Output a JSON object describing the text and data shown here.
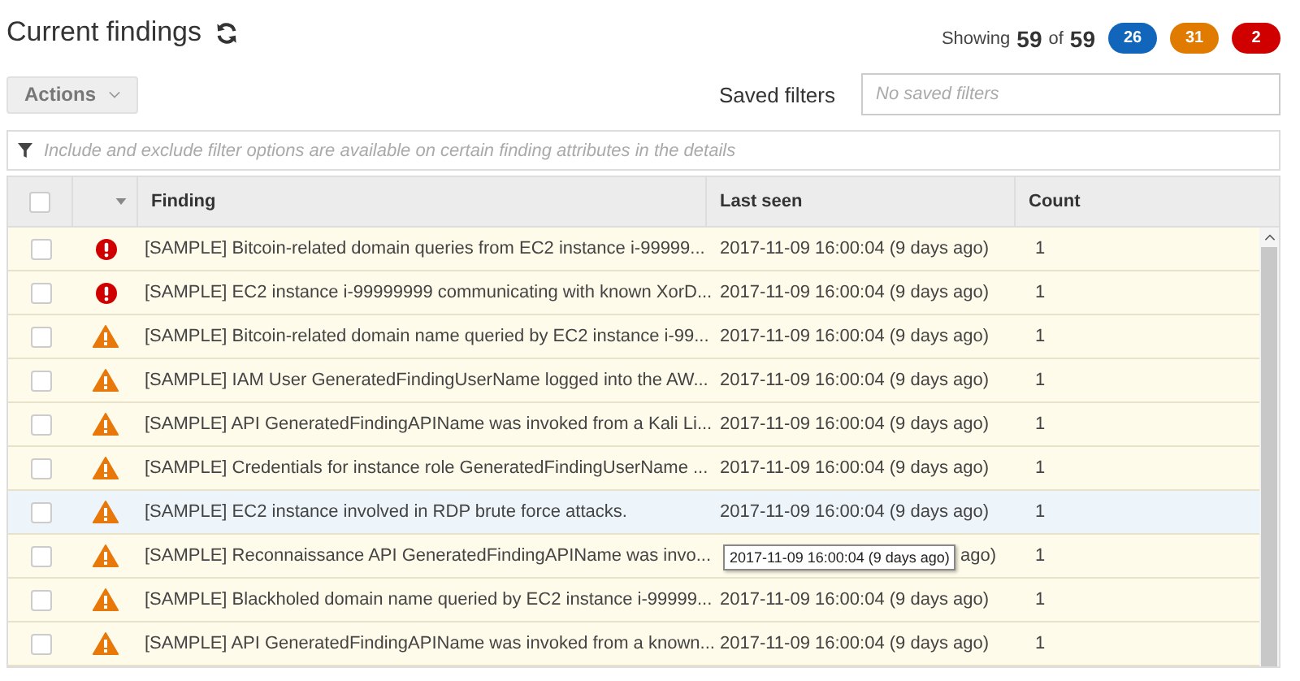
{
  "title": "Current findings",
  "summary": {
    "showing_label": "Showing",
    "shown": "59",
    "of_label": "of",
    "total": "59"
  },
  "severity_badges": [
    {
      "count": "26",
      "color": "#1166bb"
    },
    {
      "count": "31",
      "color": "#e07b00"
    },
    {
      "count": "2",
      "color": "#d00000"
    }
  ],
  "actions_button": {
    "label": "Actions"
  },
  "saved_filters": {
    "label": "Saved filters",
    "placeholder": "No saved filters"
  },
  "filter_bar": {
    "placeholder": "Include and exclude filter options are available on certain finding attributes in the details"
  },
  "table": {
    "select_all": {
      "checked": false
    },
    "columns": [
      "Finding",
      "Last seen",
      "Count"
    ],
    "rows": [
      {
        "kind": "error",
        "checked": false,
        "highlighted": false,
        "finding": "[SAMPLE] Bitcoin-related domain queries from EC2 instance i-99999...",
        "last_seen": "2017-11-09 16:00:04 (9 days ago)",
        "count": "1"
      },
      {
        "kind": "error",
        "checked": false,
        "highlighted": false,
        "finding": "[SAMPLE] EC2 instance i-99999999 communicating with known XorD...",
        "last_seen": "2017-11-09 16:00:04 (9 days ago)",
        "count": "1"
      },
      {
        "kind": "warning",
        "checked": false,
        "highlighted": false,
        "finding": "[SAMPLE] Bitcoin-related domain name queried by EC2 instance i-99...",
        "last_seen": "2017-11-09 16:00:04 (9 days ago)",
        "count": "1"
      },
      {
        "kind": "warning",
        "checked": false,
        "highlighted": false,
        "finding": "[SAMPLE] IAM User GeneratedFindingUserName logged into the AW...",
        "last_seen": "2017-11-09 16:00:04 (9 days ago)",
        "count": "1"
      },
      {
        "kind": "warning",
        "checked": false,
        "highlighted": false,
        "finding": "[SAMPLE] API GeneratedFindingAPIName was invoked from a Kali Li...",
        "last_seen": "2017-11-09 16:00:04 (9 days ago)",
        "count": "1"
      },
      {
        "kind": "warning",
        "checked": false,
        "highlighted": false,
        "finding": "[SAMPLE] Credentials for instance role GeneratedFindingUserName ...",
        "last_seen": "2017-11-09 16:00:04 (9 days ago)",
        "count": "1"
      },
      {
        "kind": "warning",
        "checked": false,
        "highlighted": true,
        "finding": "[SAMPLE] EC2 instance involved in RDP brute force attacks.",
        "last_seen": "2017-11-09 16:00:04 (9 days ago)",
        "count": "1"
      },
      {
        "kind": "warning",
        "checked": false,
        "highlighted": false,
        "finding": "[SAMPLE] Reconnaissance API GeneratedFindingAPIName was invo...",
        "last_seen": "ago)",
        "count": "1",
        "tooltip": "2017-11-09 16:00:04 (9 days ago)"
      },
      {
        "kind": "warning",
        "checked": false,
        "highlighted": false,
        "finding": "[SAMPLE] Blackholed domain name queried by EC2 instance i-99999...",
        "last_seen": "2017-11-09 16:00:04 (9 days ago)",
        "count": "1"
      },
      {
        "kind": "warning",
        "checked": false,
        "highlighted": false,
        "finding": "[SAMPLE] API GeneratedFindingAPIName was invoked from a known...",
        "last_seen": "2017-11-09 16:00:04 (9 days ago)",
        "count": "1"
      }
    ]
  }
}
